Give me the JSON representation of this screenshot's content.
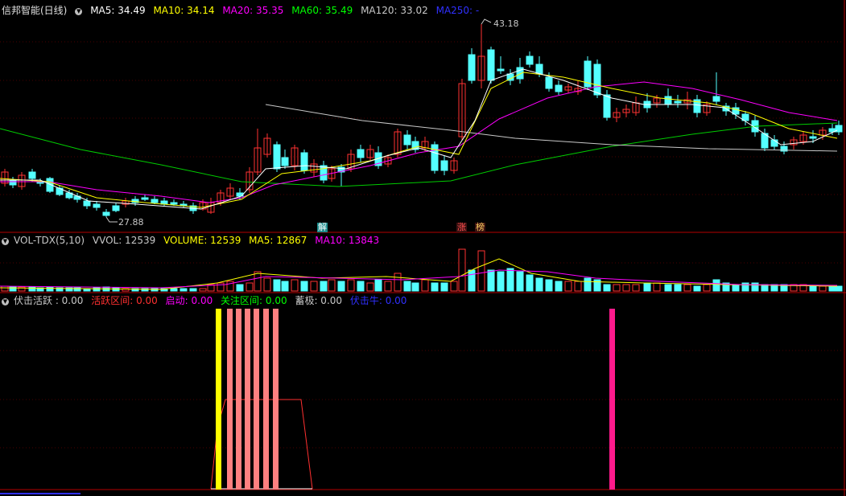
{
  "main": {
    "title": "信邦智能(日线)",
    "ma": [
      {
        "label": "MA5: 34.49",
        "color": "#ffffff"
      },
      {
        "label": "MA10: 34.14",
        "color": "#ffff00"
      },
      {
        "label": "MA20: 35.35",
        "color": "#ff00ff"
      },
      {
        "label": "MA60: 35.49",
        "color": "#00ff00"
      },
      {
        "label": "MA120: 33.02",
        "color": "#c8c8c8"
      },
      {
        "label": "MA250: -",
        "color": "#3030ff"
      }
    ],
    "high_label": "43.18",
    "low_label": "27.88",
    "tag_jie": "解",
    "tag_zhang": "涨",
    "tag_bang": "榜"
  },
  "vol": {
    "title": "VOL-TDX(5,10)",
    "items": [
      {
        "label": "VVOL: 12539",
        "color": "#c8c8c8"
      },
      {
        "label": "VOLUME: 12539",
        "color": "#ffff00"
      },
      {
        "label": "MA5: 12867",
        "color": "#ffff00"
      },
      {
        "label": "MA10: 13843",
        "color": "#ff00ff"
      }
    ]
  },
  "ind": {
    "title": "伏击活跃 : 0.00",
    "items": [
      {
        "label": "活跃区间: 0.00",
        "color": "#ff3030"
      },
      {
        "label": "启动: 0.00",
        "color": "#ff00ff"
      },
      {
        "label": "关注区间: 0.00",
        "color": "#00ff00"
      },
      {
        "label": "蓄极: 0.00",
        "color": "#c8c8c8"
      },
      {
        "label": "伏击牛: 0.00",
        "color": "#3030ff"
      }
    ]
  },
  "colors": {
    "up": "#ff3232",
    "down": "#54ffff",
    "frame": "#b40000"
  }
}
